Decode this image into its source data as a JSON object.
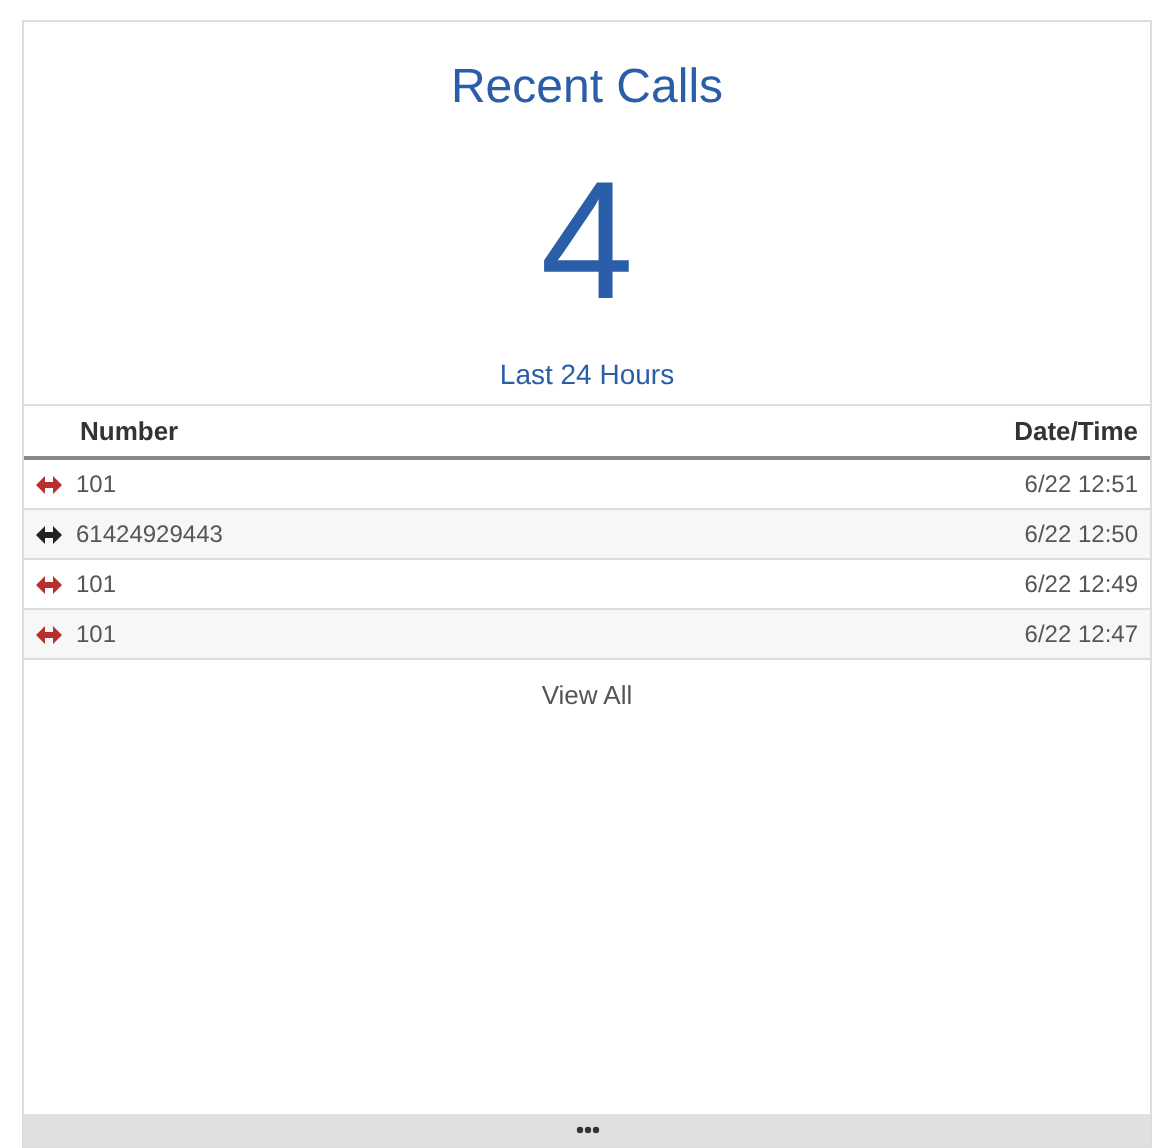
{
  "title": "Recent Calls",
  "count": "4",
  "period": "Last 24 Hours",
  "table": {
    "columns": [
      "Number",
      "Date/Time"
    ],
    "rows": [
      {
        "number": "101",
        "datetime": "6/22 12:51",
        "color": "#b5302e"
      },
      {
        "number": "61424929443",
        "datetime": "6/22 12:50",
        "color": "#222222"
      },
      {
        "number": "101",
        "datetime": "6/22 12:49",
        "color": "#b5302e"
      },
      {
        "number": "101",
        "datetime": "6/22 12:47",
        "color": "#b5302e"
      }
    ]
  },
  "link": "View All"
}
